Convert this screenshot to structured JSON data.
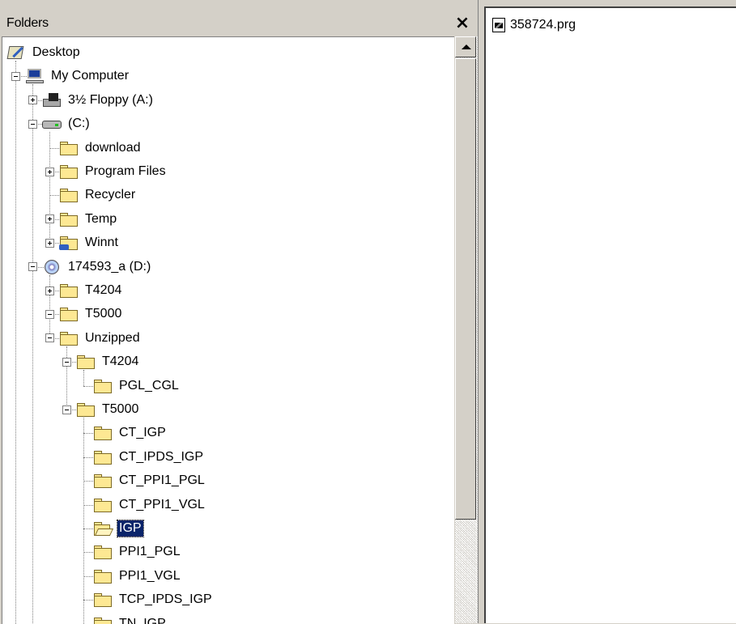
{
  "folders_pane": {
    "title": "Folders",
    "close_glyph": "×"
  },
  "tree": [
    {
      "label": "Desktop",
      "icon": "desktop-icon",
      "level": 0,
      "expander": "none"
    },
    {
      "label": "My Computer",
      "icon": "computer-icon",
      "level": 1,
      "expander": "minus"
    },
    {
      "label": "3½ Floppy (A:)",
      "icon": "floppy-drive-icon",
      "level": 2,
      "expander": "plus"
    },
    {
      "label": "(C:)",
      "icon": "hard-drive-icon",
      "level": 2,
      "expander": "minus"
    },
    {
      "label": "download",
      "icon": "folder-icon",
      "level": 3,
      "expander": "none"
    },
    {
      "label": "Program Files",
      "icon": "folder-icon",
      "level": 3,
      "expander": "plus"
    },
    {
      "label": "Recycler",
      "icon": "folder-icon",
      "level": 3,
      "expander": "none"
    },
    {
      "label": "Temp",
      "icon": "folder-icon",
      "level": 3,
      "expander": "plus"
    },
    {
      "label": "Winnt",
      "icon": "shared-folder-icon",
      "level": 3,
      "expander": "plus"
    },
    {
      "label": "174593_a (D:)",
      "icon": "cd-drive-icon",
      "level": 2,
      "expander": "minus"
    },
    {
      "label": "T4204",
      "icon": "folder-icon",
      "level": 3,
      "expander": "plus"
    },
    {
      "label": "T5000",
      "icon": "folder-icon",
      "level": 3,
      "expander": "minus"
    },
    {
      "label": "Unzipped",
      "icon": "folder-icon",
      "level": 3,
      "expander": "minus"
    },
    {
      "label": "T4204",
      "icon": "folder-icon",
      "level": 4,
      "expander": "minus"
    },
    {
      "label": "PGL_CGL",
      "icon": "folder-icon",
      "level": 5,
      "expander": "none"
    },
    {
      "label": "T5000",
      "icon": "folder-icon",
      "level": 4,
      "expander": "minus"
    },
    {
      "label": "CT_IGP",
      "icon": "folder-icon",
      "level": 5,
      "expander": "none"
    },
    {
      "label": "CT_IPDS_IGP",
      "icon": "folder-icon",
      "level": 5,
      "expander": "none"
    },
    {
      "label": "CT_PPI1_PGL",
      "icon": "folder-icon",
      "level": 5,
      "expander": "none"
    },
    {
      "label": "CT_PPI1_VGL",
      "icon": "folder-icon",
      "level": 5,
      "expander": "none"
    },
    {
      "label": "IGP",
      "icon": "open-folder-icon",
      "level": 5,
      "expander": "none",
      "selected": true
    },
    {
      "label": "PPI1_PGL",
      "icon": "folder-icon",
      "level": 5,
      "expander": "none"
    },
    {
      "label": "PPI1_VGL",
      "icon": "folder-icon",
      "level": 5,
      "expander": "none"
    },
    {
      "label": "TCP_IPDS_IGP",
      "icon": "folder-icon",
      "level": 5,
      "expander": "none"
    },
    {
      "label": "TN_IGP",
      "icon": "folder-icon",
      "level": 5,
      "expander": "none"
    }
  ],
  "files_pane": {
    "items": [
      {
        "name": "358724.prg",
        "icon": "program-file-icon"
      }
    ]
  },
  "colors": {
    "selection": "#0a246a",
    "window_face": "#d4d0c8",
    "folder": "#fde893"
  }
}
